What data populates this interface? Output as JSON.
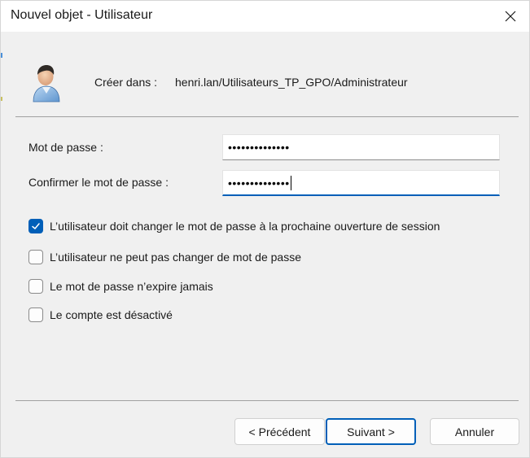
{
  "window": {
    "title": "Nouvel objet - Utilisateur",
    "close_icon": "close-icon"
  },
  "header": {
    "icon": "user-icon",
    "create_in_label": "Créer dans :",
    "create_in_path": "henri.lan/Utilisateurs_TP_GPO/Administrateur"
  },
  "form": {
    "password_label": "Mot de passe :",
    "password_value": "••••••••••••••",
    "confirm_label": "Confirmer le mot de passe :",
    "confirm_value": "••••••••••••••"
  },
  "options": [
    {
      "label": "L’utilisateur doit changer le mot de passe à la prochaine ouverture de session",
      "checked": true
    },
    {
      "label": "L’utilisateur ne peut pas changer de mot de passe",
      "checked": false
    },
    {
      "label": "Le mot de passe n’expire jamais",
      "checked": false
    },
    {
      "label": "Le compte est désactivé",
      "checked": false
    }
  ],
  "buttons": {
    "previous": "< Précédent",
    "next": "Suivant >",
    "cancel": "Annuler"
  },
  "colors": {
    "accent": "#005fb8",
    "background": "#f0f0f0"
  }
}
